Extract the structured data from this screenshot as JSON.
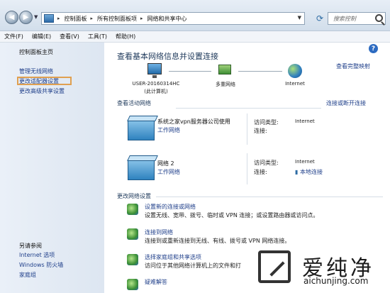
{
  "address": {
    "crumbs": [
      "控制面板",
      "所有控制面板项",
      "网络和共享中心"
    ],
    "search_placeholder": "搜索控制"
  },
  "menu": [
    "文件(F)",
    "编辑(E)",
    "查看(V)",
    "工具(T)",
    "帮助(H)"
  ],
  "sidebar": {
    "home": "控制面板主页",
    "links": [
      "管理无线网络",
      "更改适配器设置",
      "更改高级共享设置"
    ],
    "see_also_title": "另请参阅",
    "see_also": [
      "Internet 选项",
      "Windows 防火墙",
      "家庭组"
    ]
  },
  "main": {
    "title": "查看基本网络信息并设置连接",
    "full_map": "查看完整映射",
    "map": {
      "pc_name": "USER-20160314HC",
      "pc_sub": "(此计算机)",
      "network": "多重网络",
      "internet": "Internet"
    },
    "active_head": "查看活动网络",
    "connect_link": "连接或断开连接",
    "networks": [
      {
        "name": "系统之家vpn服务器公司使用",
        "type": "工作网络",
        "access_key": "访问类型:",
        "access_val": "Internet",
        "conn_key": "连接:",
        "conn_val": ""
      },
      {
        "name": "网络  2",
        "type": "工作网络",
        "access_key": "访问类型:",
        "access_val": "Internet",
        "conn_key": "连接:",
        "conn_val": "本地连接"
      }
    ],
    "change_head": "更改网络设置",
    "tasks": [
      {
        "title": "设置新的连接或网络",
        "desc": "设置无线、宽带、拨号、临时或 VPN 连接；或设置路由器或访问点。"
      },
      {
        "title": "连接到网络",
        "desc": "连接到或重新连接到无线、有线、拨号或 VPN 网络连接。"
      },
      {
        "title": "选择家庭组和共享选项",
        "desc": "访问位于其他网络计算机上的文件和打"
      },
      {
        "title": "疑难解答",
        "desc": ""
      }
    ]
  },
  "watermark": {
    "cn": "爱纯净",
    "url": "aichunjing.com"
  }
}
